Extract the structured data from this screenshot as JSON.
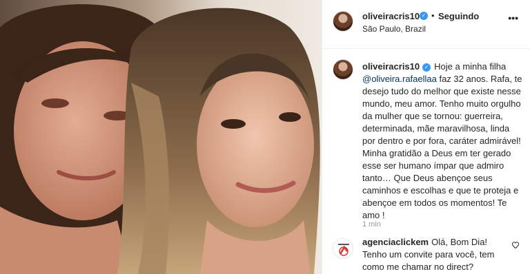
{
  "post": {
    "username": "oliveiracris10",
    "separator": "•",
    "follow_status": "Seguindo",
    "location": "São Paulo, Brazil",
    "more_icon": "ellipsis-icon"
  },
  "caption": {
    "username": "oliveiracris10",
    "text_before": "Hoje a minha filha ",
    "mention": "@oliveira.rafaellaa",
    "text_after": " faz 32 anos. Rafa, te desejo tudo do melhor que existe nesse mundo, meu amor. Tenho muito orgulho da mulher que se tornou: guerreira, determinada, mãe maravilhosa, linda por dentro e por fora, caráter admirável! Minha gratidão a Deus em ter gerado esse ser humano ímpar que admiro tanto… Que Deus abençoe seus caminhos e escolhas e que te proteja e abençoe em todos os momentos! Te amo !",
    "time": "1 min"
  },
  "comment": {
    "username": "agenciaclickem",
    "text": "Olá, Bom Dia! Tenho um convite para você, tem como me chamar no direct?"
  },
  "icons": {
    "verified": "verified-badge-icon",
    "like": "heart-icon"
  },
  "colors": {
    "verified_blue": "#3897f0",
    "mention": "#003569",
    "muted": "#999999",
    "text": "#262626"
  }
}
